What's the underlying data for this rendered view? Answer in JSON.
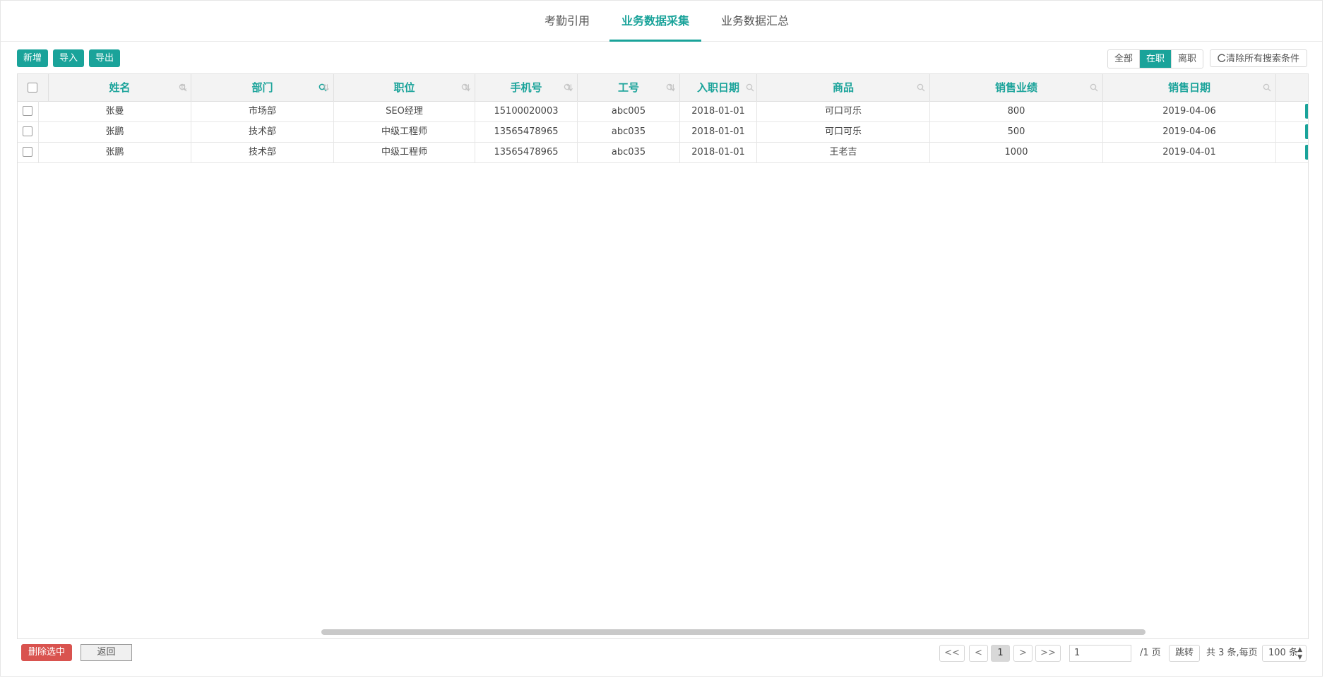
{
  "tabs": [
    {
      "label": "考勤引用"
    },
    {
      "label": "业务数据采集"
    },
    {
      "label": "业务数据汇总"
    }
  ],
  "toolbar": {
    "add_label": "新增",
    "import_label": "导入",
    "export_label": "导出",
    "filter_all": "全部",
    "filter_active": "在职",
    "filter_left": "离职",
    "clear_search": "清除所有搜索条件"
  },
  "table": {
    "columns": [
      "姓名",
      "部门",
      "职位",
      "手机号",
      "工号",
      "入职日期",
      "商品",
      "销售业绩",
      "销售日期"
    ],
    "sort_icon": "⇅",
    "rows": [
      [
        "张曼",
        "市场部",
        "SEO经理",
        "15100020003",
        "abc005",
        "2018-01-01",
        "可口可乐",
        "800",
        "2019-04-06"
      ],
      [
        "张鹏",
        "技术部",
        "中级工程师",
        "13565478965",
        "abc035",
        "2018-01-01",
        "可口可乐",
        "500",
        "2019-04-06"
      ],
      [
        "张鹏",
        "技术部",
        "中级工程师",
        "13565478965",
        "abc035",
        "2018-01-01",
        "王老吉",
        "1000",
        "2019-04-01"
      ]
    ]
  },
  "footer": {
    "delete_label": "删除选中",
    "back_label": "返回",
    "first": "<<",
    "prev": "<",
    "current_page": "1",
    "next": ">",
    "last": ">>",
    "page_input": "1",
    "total_pages": "/1 页",
    "jump_label": "跳转",
    "summary": "共 3 条,每页",
    "page_size": "100 条"
  },
  "colors": {
    "accent": "#1aa39a",
    "danger": "#d9534f"
  },
  "icons": {
    "search": "search-icon",
    "sort": "sort-icon",
    "refresh": "refresh-icon"
  }
}
